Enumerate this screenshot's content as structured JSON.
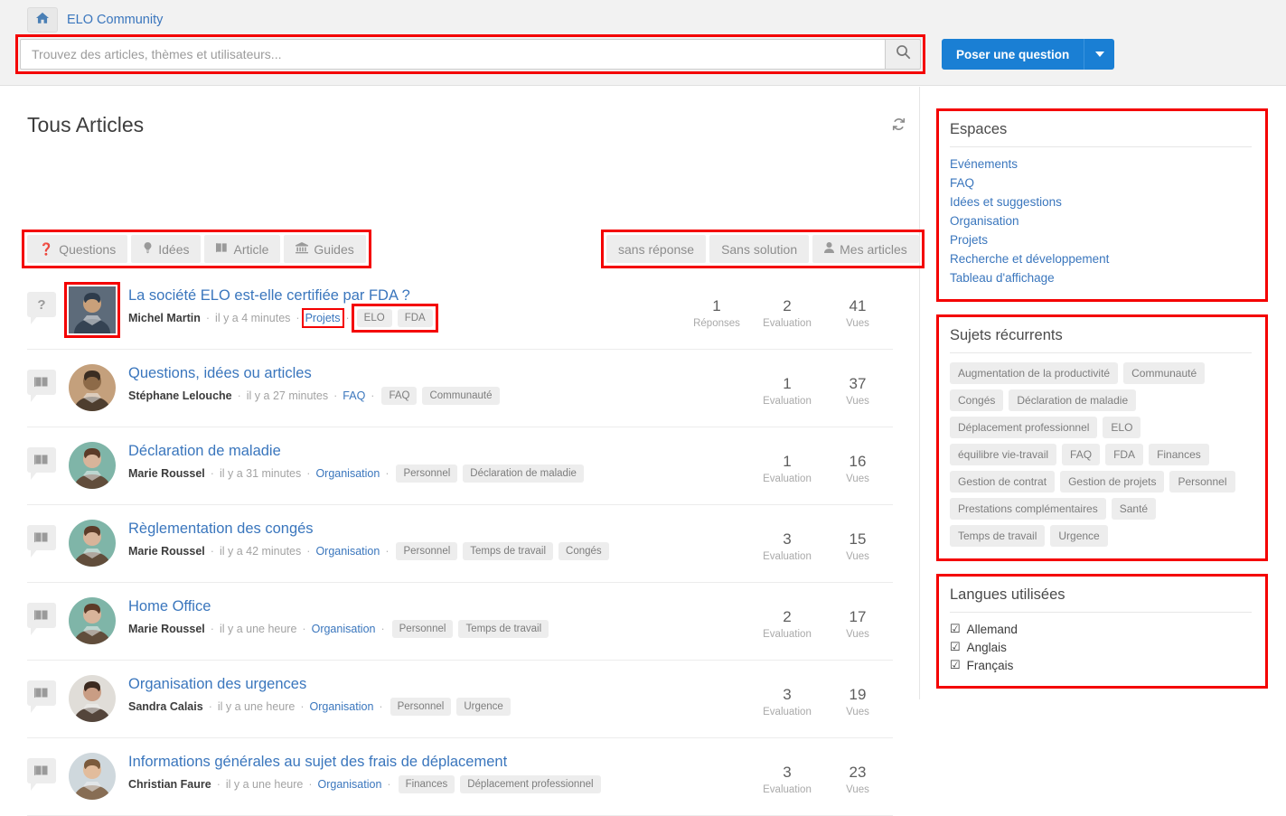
{
  "topbar": {
    "home_icon": "home-icon",
    "breadcrumb": "ELO Community",
    "search": {
      "placeholder": "Trouvez des articles, thèmes et utilisateurs...",
      "value": "",
      "icon": "search-icon"
    },
    "ask_button": "Poser une question",
    "ask_caret_icon": "chevron-down-icon",
    "accent_color": "#1a7fd4",
    "highlight_color": "#f40000"
  },
  "main": {
    "title": "Tous Articles",
    "refresh_icon": "refresh-icon",
    "type_filters": [
      {
        "label": "Questions",
        "icon": "question-mark-icon",
        "glyph": "?"
      },
      {
        "label": "Idées",
        "icon": "lightbulb-icon",
        "glyph": " "
      },
      {
        "label": "Article",
        "icon": "book-icon",
        "glyph": " "
      },
      {
        "label": "Guides",
        "icon": "bank-icon",
        "glyph": " "
      }
    ],
    "status_filters": [
      {
        "label": "sans réponse",
        "icon": ""
      },
      {
        "label": "Sans solution",
        "icon": ""
      },
      {
        "label": "Mes articles",
        "icon": "user-icon"
      }
    ],
    "stat_labels": {
      "replies": "Réponses",
      "rating": "Evaluation",
      "views": "Vues"
    },
    "articles": [
      {
        "type": "question",
        "type_icon": "question-bubble-icon",
        "title": "La société ELO est-elle certifiée par FDA ?",
        "author": "Michel Martin",
        "time": "il y a 4 minutes",
        "space": "Projets",
        "tags": [
          "ELO",
          "FDA"
        ],
        "replies": "1",
        "rating": "2",
        "views": "41",
        "avatar_highlighted": true,
        "space_highlighted": true,
        "tags_highlighted": true,
        "show_replies": true,
        "avatar_colors": [
          "#5d6b7a",
          "#2e3c4c",
          "#c9a07a"
        ]
      },
      {
        "type": "article",
        "type_icon": "article-bubble-icon",
        "title": "Questions, idées ou articles",
        "author": "Stéphane Lelouche",
        "time": "il y a 27 minutes",
        "space": "FAQ",
        "tags": [
          "FAQ",
          "Communauté"
        ],
        "replies": "",
        "rating": "1",
        "views": "37",
        "avatar_highlighted": false,
        "space_highlighted": false,
        "tags_highlighted": false,
        "show_replies": false,
        "avatar_colors": [
          "#c4a07c",
          "#3a2d22",
          "#8d6a48"
        ]
      },
      {
        "type": "article",
        "type_icon": "article-bubble-icon",
        "title": "Déclaration de maladie",
        "author": "Marie Roussel",
        "time": "il y a 31 minutes",
        "space": "Organisation",
        "tags": [
          "Personnel",
          "Déclaration de maladie"
        ],
        "replies": "",
        "rating": "1",
        "views": "16",
        "avatar_highlighted": false,
        "space_highlighted": false,
        "tags_highlighted": false,
        "show_replies": false,
        "avatar_colors": [
          "#7fb5a8",
          "#5c3b28",
          "#d8b49a"
        ]
      },
      {
        "type": "article",
        "type_icon": "article-bubble-icon",
        "title": "Règlementation des congés",
        "author": "Marie Roussel",
        "time": "il y a 42 minutes",
        "space": "Organisation",
        "tags": [
          "Personnel",
          "Temps de travail",
          "Congés"
        ],
        "replies": "",
        "rating": "3",
        "views": "15",
        "avatar_highlighted": false,
        "space_highlighted": false,
        "tags_highlighted": false,
        "show_replies": false,
        "avatar_colors": [
          "#7fb5a8",
          "#5c3b28",
          "#d8b49a"
        ]
      },
      {
        "type": "article",
        "type_icon": "article-bubble-icon",
        "title": "Home Office",
        "author": "Marie Roussel",
        "time": "il y a une heure",
        "space": "Organisation",
        "tags": [
          "Personnel",
          "Temps de travail"
        ],
        "replies": "",
        "rating": "2",
        "views": "17",
        "avatar_highlighted": false,
        "space_highlighted": false,
        "tags_highlighted": false,
        "show_replies": false,
        "avatar_colors": [
          "#7fb5a8",
          "#5c3b28",
          "#d8b49a"
        ]
      },
      {
        "type": "article",
        "type_icon": "article-bubble-icon",
        "title": "Organisation des urgences",
        "author": "Sandra Calais",
        "time": "il y a une heure",
        "space": "Organisation",
        "tags": [
          "Personnel",
          "Urgence"
        ],
        "replies": "",
        "rating": "3",
        "views": "19",
        "avatar_highlighted": false,
        "space_highlighted": false,
        "tags_highlighted": false,
        "show_replies": false,
        "avatar_colors": [
          "#e0ddd8",
          "#3b2a20",
          "#c99d84"
        ]
      },
      {
        "type": "article",
        "type_icon": "article-bubble-icon",
        "title": "Informations générales au sujet des frais de déplacement",
        "author": "Christian Faure",
        "time": "il y a une heure",
        "space": "Organisation",
        "tags": [
          "Finances",
          "Déplacement professionnel"
        ],
        "replies": "",
        "rating": "3",
        "views": "23",
        "avatar_highlighted": false,
        "space_highlighted": false,
        "tags_highlighted": false,
        "show_replies": false,
        "avatar_colors": [
          "#cfd8dd",
          "#7a5a3c",
          "#e2bc9c"
        ]
      }
    ]
  },
  "sidebar": {
    "spaces": {
      "title": "Espaces",
      "items": [
        "Evénements",
        "FAQ",
        "Idées et suggestions",
        "Organisation",
        "Projets",
        "Recherche et développement",
        "Tableau d'affichage"
      ]
    },
    "topics": {
      "title": "Sujets récurrents",
      "items": [
        "Augmentation de la productivité",
        "Communauté",
        "Congés",
        "Déclaration de maladie",
        "Déplacement professionnel",
        "ELO",
        "équilibre vie-travail",
        "FAQ",
        "FDA",
        "Finances",
        "Gestion de contrat",
        "Gestion de projets",
        "Personnel",
        "Prestations complémentaires",
        "Santé",
        "Temps de travail",
        "Urgence"
      ]
    },
    "languages": {
      "title": "Langues utilisées",
      "items": [
        {
          "label": "Allemand",
          "checked": true
        },
        {
          "label": "Anglais",
          "checked": true
        },
        {
          "label": "Français",
          "checked": true
        }
      ]
    }
  }
}
